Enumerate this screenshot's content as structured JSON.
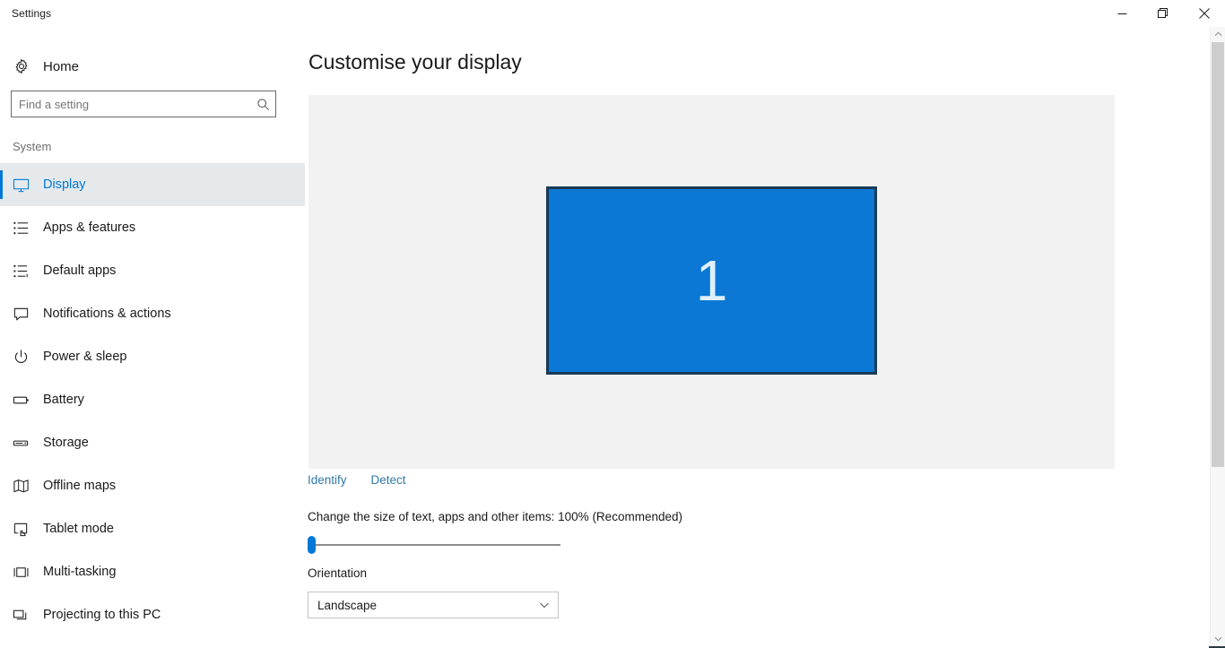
{
  "window": {
    "title": "Settings",
    "controls": {
      "minimize": "minimize-button",
      "restore": "restore-button",
      "close": "close-button"
    }
  },
  "sidebar": {
    "home_label": "Home",
    "home_icon": "gear-icon",
    "search": {
      "placeholder": "Find a setting",
      "value": "",
      "icon": "search-icon"
    },
    "group_label": "System",
    "items": [
      {
        "label": "Display",
        "icon": "monitor-icon",
        "selected": true
      },
      {
        "label": "Apps & features",
        "icon": "list-icon",
        "selected": false
      },
      {
        "label": "Default apps",
        "icon": "list-arrow-icon",
        "selected": false
      },
      {
        "label": "Notifications & actions",
        "icon": "speech-bubble-icon",
        "selected": false
      },
      {
        "label": "Power & sleep",
        "icon": "power-icon",
        "selected": false
      },
      {
        "label": "Battery",
        "icon": "battery-icon",
        "selected": false
      },
      {
        "label": "Storage",
        "icon": "drive-icon",
        "selected": false
      },
      {
        "label": "Offline maps",
        "icon": "map-download-icon",
        "selected": false
      },
      {
        "label": "Tablet mode",
        "icon": "tablet-touch-icon",
        "selected": false
      },
      {
        "label": "Multi-tasking",
        "icon": "multitask-icon",
        "selected": false
      },
      {
        "label": "Projecting to this PC",
        "icon": "project-screen-icon",
        "selected": false
      }
    ]
  },
  "main": {
    "page_title": "Customise your display",
    "preview": {
      "monitor_number": "1",
      "monitor_color": "#0a78d4",
      "monitor_border_color": "#1b3a54",
      "panel_background": "#f2f2f2"
    },
    "links": [
      {
        "label": "Identify",
        "name": "identify-link"
      },
      {
        "label": "Detect",
        "name": "detect-link"
      }
    ],
    "scale": {
      "label": "Change the size of text, apps and other items: 100% (Recommended)",
      "value": 100,
      "slider_position_percent": 0
    },
    "orientation": {
      "label": "Orientation",
      "selected": "Landscape",
      "arrow_icon": "chevron-down-icon"
    }
  },
  "scrollbar": {
    "up_icon": "chevron-up-icon",
    "down_icon": "chevron-down-icon"
  },
  "colors": {
    "accent": "#0078d7",
    "link": "#2f79a8",
    "selected_row_bg": "#e6e9ec"
  }
}
